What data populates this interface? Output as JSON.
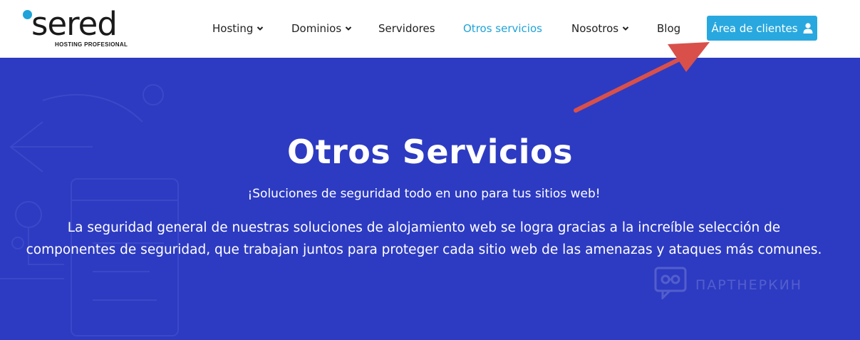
{
  "logo": {
    "wordmark": "sered",
    "tagline": "HOSTING PROFESIONAL",
    "accent_color": "#1fa3d8"
  },
  "nav": {
    "items": [
      {
        "label": "Hosting",
        "dropdown": true,
        "active": false
      },
      {
        "label": "Dominios",
        "dropdown": true,
        "active": false
      },
      {
        "label": "Servidores",
        "dropdown": false,
        "active": false
      },
      {
        "label": "Otros servicios",
        "dropdown": false,
        "active": true
      },
      {
        "label": "Nosotros",
        "dropdown": true,
        "active": false
      },
      {
        "label": "Blog",
        "dropdown": false,
        "active": false
      }
    ],
    "cta": {
      "label": "Área de clientes",
      "icon": "user-icon",
      "color": "#28a8df"
    }
  },
  "hero": {
    "background": "#2d3bc2",
    "title": "Otros Servicios",
    "subtitle": "¡Soluciones de seguridad todo en uno para tus sitios web!",
    "body": "La seguridad general de nuestras soluciones de alojamiento web se logra gracias a la increíble selección de componentes de seguridad, que trabajan juntos para proteger cada sitio web de las amenazas y ataques más comunes."
  },
  "watermark": {
    "text": "ПАРТНЕРКИН",
    "icon": "chat-glasses-icon"
  },
  "annotation": {
    "icon": "red-arrow-icon",
    "color": "#d9504a"
  }
}
